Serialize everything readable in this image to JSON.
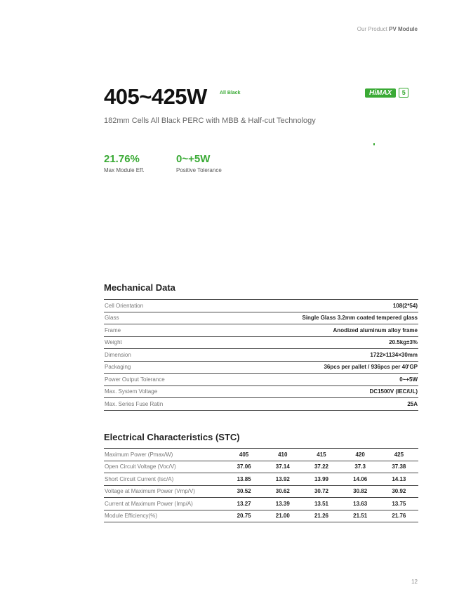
{
  "header": {
    "prefix": "Our Product",
    "section": "PV Module"
  },
  "title": "405~425W",
  "title_badge": "All Black",
  "brand": {
    "name": "HiMAX",
    "number": "5",
    "accent": "#3aaa35"
  },
  "subtitle": "182mm Cells All Black PERC with MBB & Half-cut Technology",
  "kpis": [
    {
      "value": "21.76%",
      "label": "Max Module Eff."
    },
    {
      "value": "0~+5W",
      "label": "Positive Tolerance"
    }
  ],
  "mechanical": {
    "title": "Mechanical Data",
    "rows": [
      {
        "k": "Cell Orientation",
        "v": "108(2*54)"
      },
      {
        "k": "Glass",
        "v": "Single Glass 3.2mm coated tempered glass"
      },
      {
        "k": "Frame",
        "v": "Anodized aluminum alloy frame"
      },
      {
        "k": "Weight",
        "v": "20.5kg±3%"
      },
      {
        "k": "Dimension",
        "v": "1722×1134×30mm"
      },
      {
        "k": "Packaging",
        "v": "36pcs per pallet / 936pcs per 40'GP"
      },
      {
        "k": "Power Output Tolerance",
        "v": "0~+5W"
      },
      {
        "k": "Max. System Voltage",
        "v": "DC1500V (IEC/UL)"
      },
      {
        "k": "Max. Series Fuse Ratin",
        "v": "25A"
      }
    ]
  },
  "electrical": {
    "title": "Electrical Characteristics (STC)",
    "rows": [
      {
        "k": "Maximum Power (Pmax/W)",
        "v": [
          "405",
          "410",
          "415",
          "420",
          "425"
        ]
      },
      {
        "k": "Open Circuit Voltage (Voc/V)",
        "v": [
          "37.06",
          "37.14",
          "37.22",
          "37.3",
          "37.38"
        ]
      },
      {
        "k": "Short Circuit Current (Isc/A)",
        "v": [
          "13.85",
          "13.92",
          "13.99",
          "14.06",
          "14.13"
        ]
      },
      {
        "k": "Voltage at Maximum Power (Vmp/V)",
        "v": [
          "30.52",
          "30.62",
          "30.72",
          "30.82",
          "30.92"
        ]
      },
      {
        "k": "Current at Maximum Power (Imp/A)",
        "v": [
          "13.27",
          "13.39",
          "13.51",
          "13.63",
          "13.75"
        ]
      },
      {
        "k": "Module Efficiency(%)",
        "v": [
          "20.75",
          "21.00",
          "21.26",
          "21.51",
          "21.76"
        ]
      }
    ]
  },
  "page_number": "12"
}
